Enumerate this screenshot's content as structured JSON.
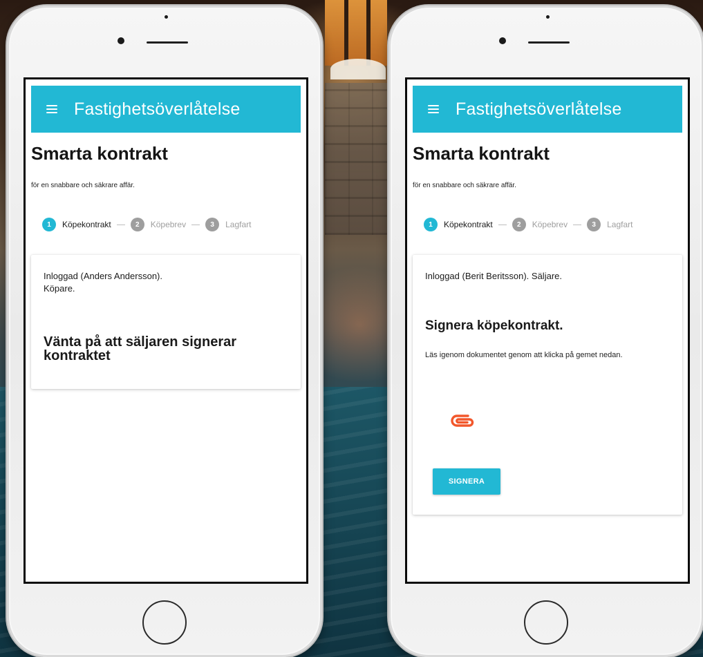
{
  "colors": {
    "accent": "#22b8d4",
    "paperclip": "#f2572b",
    "step_inactive": "#9e9e9e"
  },
  "phones": [
    {
      "app_bar": {
        "menu_icon": "hamburger-menu-icon",
        "title": "Fastighetsöverlåtelse"
      },
      "hero": {
        "title": "Smarta kontrakt",
        "subtitle": "för en snabbare och säkrare affär."
      },
      "stepper": {
        "steps": [
          {
            "number": "1",
            "label": "Köpekontrakt",
            "state": "active"
          },
          {
            "number": "2",
            "label": "Köpebrev",
            "state": "inactive"
          },
          {
            "number": "3",
            "label": "Lagfart",
            "state": "inactive"
          }
        ]
      },
      "card": {
        "status_line1": "Inloggad (Anders Andersson).",
        "status_line2": "Köpare.",
        "heading": "Vänta på att säljaren signerar kontraktet"
      }
    },
    {
      "app_bar": {
        "menu_icon": "hamburger-menu-icon",
        "title": "Fastighetsöverlåtelse"
      },
      "hero": {
        "title": "Smarta kontrakt",
        "subtitle": "för en snabbare och säkrare affär."
      },
      "stepper": {
        "steps": [
          {
            "number": "1",
            "label": "Köpekontrakt",
            "state": "active"
          },
          {
            "number": "2",
            "label": "Köpebrev",
            "state": "inactive"
          },
          {
            "number": "3",
            "label": "Lagfart",
            "state": "inactive"
          }
        ]
      },
      "card": {
        "status": "Inloggad (Berit Beritsson). Säljare.",
        "heading": "Signera köpekontrakt.",
        "instructions": "Läs igenom dokumentet genom att klicka på gemet nedan.",
        "attachment_icon": "paperclip-icon",
        "sign_button_label": "SIGNERA"
      }
    }
  ]
}
